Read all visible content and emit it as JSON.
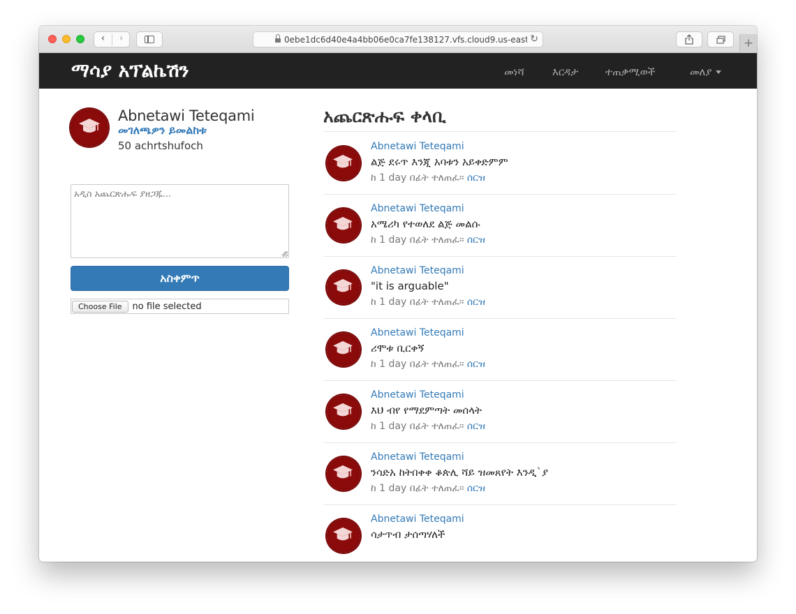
{
  "browser": {
    "url": "0ebe1dc6d40e4a4bb06e0ca7fe138127.vfs.cloud9.us-east-"
  },
  "navbar": {
    "brand": "ማሳያ አፕልኬሽን",
    "items": [
      {
        "label": "መነሻ"
      },
      {
        "label": "እርዳታ"
      },
      {
        "label": "ተጠቃሚወች"
      },
      {
        "label": "መለያ"
      }
    ]
  },
  "profile": {
    "name": "Abnetawi Teteqami",
    "edit_label": "መገለጫዎን ይመልከቱ",
    "count": "50 achrtshufoch"
  },
  "compose": {
    "placeholder": "አዲስ አጨርጽሑፍ ያዘጋጁ...",
    "submit_label": "አስቀምጥ",
    "file_button": "Choose File",
    "file_status": "no file selected"
  },
  "feed": {
    "title": "አጨርጽሑፍ ቀላቢ",
    "items": [
      {
        "author": "Abnetawi Teteqami",
        "text": "ልጅ ደሩጥ እንጂ አባቱን አይቀድምም",
        "meta": "ከ 1 day በፊት ተለጠፈ።",
        "delete": "ሰርዝ"
      },
      {
        "author": "Abnetawi Teteqami",
        "text": "አሜሪካ የተወለደ ልጅ መልሱ",
        "meta": "ከ 1 day በፊት ተለጠፈ።",
        "delete": "ሰርዝ"
      },
      {
        "author": "Abnetawi Teteqami",
        "text": "\"it is arguable\"",
        "meta": "ከ 1 day በፊት ተለጠፈ።",
        "delete": "ሰርዝ"
      },
      {
        "author": "Abnetawi Teteqami",
        "text": "ሪሞቱ ቢርቀኝ",
        "meta": "ከ 1 day በፊት ተለጠፈ።",
        "delete": "ሰርዝ"
      },
      {
        "author": "Abnetawi Teteqami",
        "text": "እህ ብየ የማደምጣት መሰላት",
        "meta": "ከ 1 day በፊት ተለጠፈ።",
        "delete": "ሰርዝ"
      },
      {
        "author": "Abnetawi Teteqami",
        "text": "ንሳድአ ከትበቀቀ ቆጵሊ ሻይ ዝመጸየት እንዲ`ያ",
        "meta": "ከ 1 day በፊት ተለጠፈ።",
        "delete": "ሰርዝ"
      },
      {
        "author": "Abnetawi Teteqami",
        "text": "ሳታጥብ ታሰጣሃለች",
        "meta": "",
        "delete": ""
      }
    ]
  },
  "colors": {
    "navbar_bg": "#222222",
    "link": "#337ab7",
    "primary_button": "#337ab7",
    "avatar": "#8b0a0a"
  }
}
